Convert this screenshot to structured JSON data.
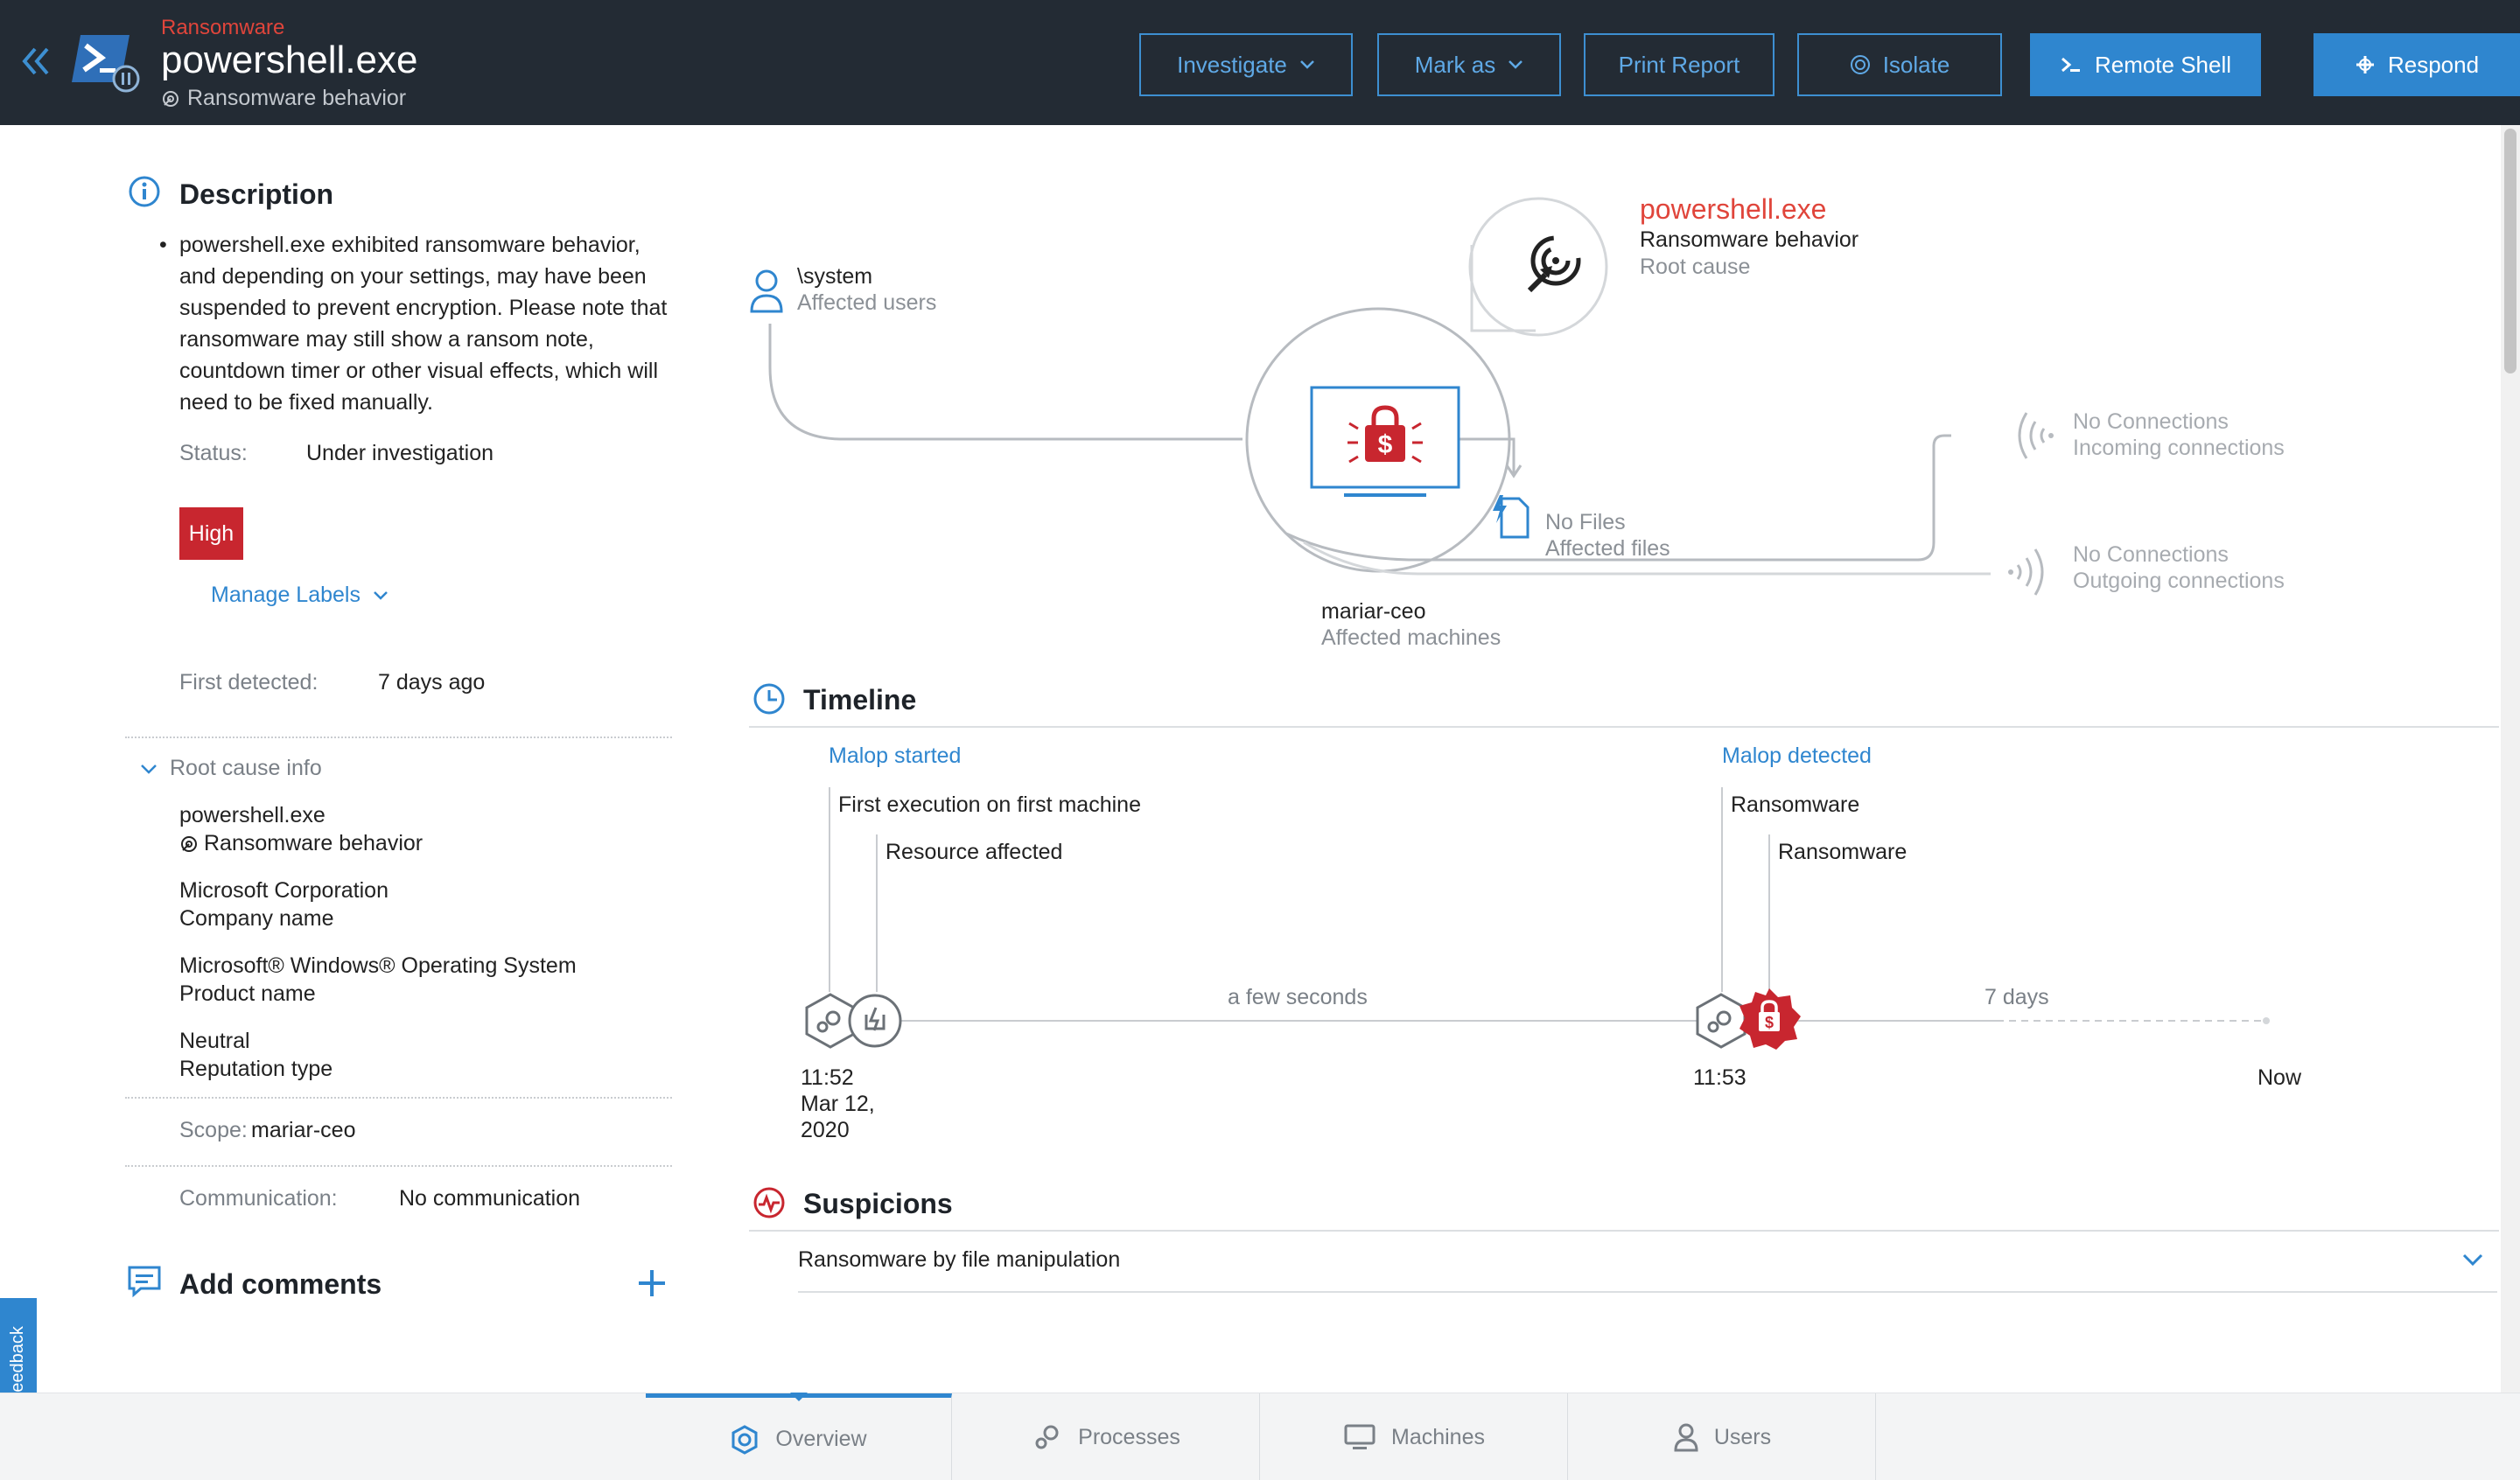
{
  "header": {
    "category": "Ransomware",
    "title": "powershell.exe",
    "subtitle": "Ransomware behavior",
    "buttons": {
      "investigate": "Investigate",
      "mark_as": "Mark as",
      "print_report": "Print Report",
      "isolate": "Isolate",
      "remote_shell": "Remote Shell",
      "respond": "Respond"
    }
  },
  "description": {
    "heading": "Description",
    "text": "powershell.exe exhibited ransomware behavior, and depending on your settings, may have been suspended to prevent encryption. Please note that ransomware may still show a ransom note, countdown timer or other visual effects, which will need to be fixed manually.",
    "status_label": "Status:",
    "status_value": "Under investigation",
    "severity": "High",
    "manage_labels": "Manage Labels",
    "first_detected_label": "First detected:",
    "first_detected_value": "7 days ago"
  },
  "root_cause_info": {
    "heading": "Root cause info",
    "process": "powershell.exe",
    "behavior": "Ransomware behavior",
    "company_value": "Microsoft Corporation",
    "company_label": "Company name",
    "product_value": "Microsoft® Windows® Operating System",
    "product_label": "Product name",
    "reputation_value": "Neutral",
    "reputation_label": "Reputation type"
  },
  "scope": {
    "label": "Scope:",
    "value": "mariar-ceo"
  },
  "communication": {
    "label": "Communication:",
    "value": "No communication"
  },
  "comments": {
    "heading": "Add comments"
  },
  "graph": {
    "root_title": "powershell.exe",
    "root_behavior": "Ransomware behavior",
    "root_label": "Root cause",
    "users_value": "\\system",
    "users_label": "Affected users",
    "files_value": "No Files",
    "files_label": "Affected files",
    "incoming_value": "No Connections",
    "incoming_label": "Incoming connections",
    "outgoing_value": "No Connections",
    "outgoing_label": "Outgoing connections",
    "machine_value": "mariar-ceo",
    "machine_label": "Affected machines"
  },
  "timeline": {
    "heading": "Timeline",
    "malop_started": "Malop started",
    "first_execution": "First execution on first machine",
    "resource_affected": "Resource affected",
    "malop_detected": "Malop detected",
    "ransomware_1": "Ransomware",
    "ransomware_2": "Ransomware",
    "gap_1": "a few seconds",
    "gap_2": "7 days",
    "time_start": "11:52",
    "date_line1": "Mar 12,",
    "date_line2": "2020",
    "time_detected": "11:53",
    "now": "Now"
  },
  "suspicions": {
    "heading": "Suspicions",
    "item": "Ransomware by file manipulation"
  },
  "tabs": {
    "overview": "Overview",
    "processes": "Processes",
    "machines": "Machines",
    "users": "Users"
  },
  "feedback": "Feedback",
  "colors": {
    "header_bg": "#232b34",
    "accent": "#2f86cf",
    "danger": "#c8262f"
  }
}
